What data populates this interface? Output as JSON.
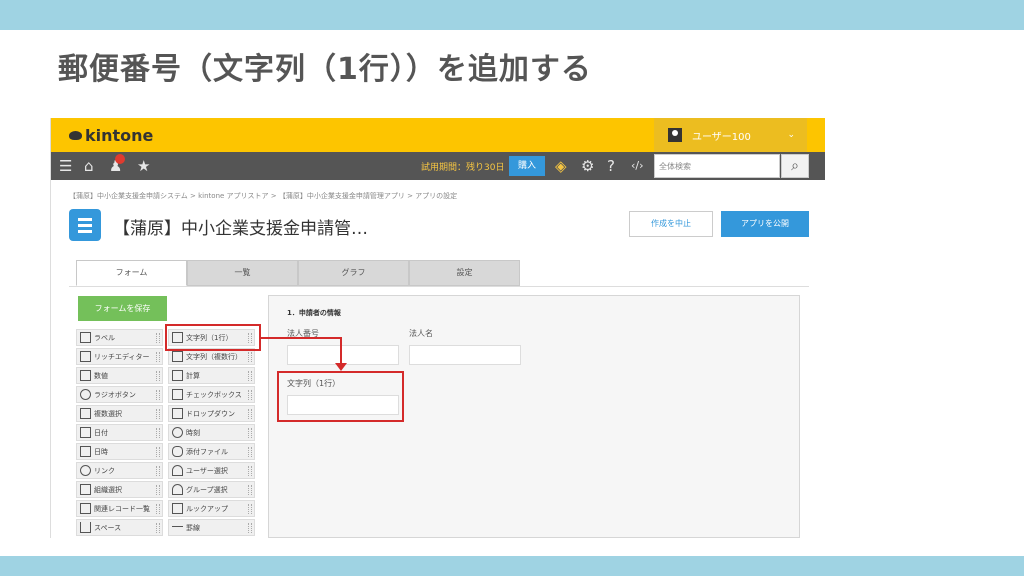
{
  "slide": {
    "title": "郵便番号（文字列（1行））を追加する"
  },
  "kintone": {
    "logo_text": "kintone",
    "user_name": "ユーザー100",
    "trial_text": "試用期間：残り30日",
    "buy_label": "購入",
    "search_placeholder": "全体検索",
    "breadcrumb": "【蒲原】中小企業支援金申請システム  >  kintone アプリストア  >  【蒲原】中小企業支援金申請管理アプリ  >  アプリの設定",
    "app_title": "【蒲原】中小企業支援金申請管…",
    "cancel_label": "作成を中止",
    "publish_label": "アプリを公開",
    "tabs": [
      {
        "label": "フォーム"
      },
      {
        "label": "一覧"
      },
      {
        "label": "グラフ"
      },
      {
        "label": "設定"
      }
    ],
    "save_form_label": "フォームを保存",
    "palette": [
      {
        "label": "ラベル",
        "icon": "label-icon"
      },
      {
        "label": "文字列（1行）",
        "icon": "text-single-icon"
      },
      {
        "label": "リッチエディター",
        "icon": "rich-editor-icon"
      },
      {
        "label": "文字列（複数行）",
        "icon": "text-multi-icon"
      },
      {
        "label": "数値",
        "icon": "number-icon"
      },
      {
        "label": "計算",
        "icon": "calc-icon"
      },
      {
        "label": "ラジオボタン",
        "icon": "radio-icon"
      },
      {
        "label": "チェックボックス",
        "icon": "checkbox-icon"
      },
      {
        "label": "複数選択",
        "icon": "multi-select-icon"
      },
      {
        "label": "ドロップダウン",
        "icon": "dropdown-icon"
      },
      {
        "label": "日付",
        "icon": "date-icon"
      },
      {
        "label": "時刻",
        "icon": "clock-icon"
      },
      {
        "label": "日時",
        "icon": "datetime-icon"
      },
      {
        "label": "添付ファイル",
        "icon": "attachment-icon"
      },
      {
        "label": "リンク",
        "icon": "link-icon"
      },
      {
        "label": "ユーザー選択",
        "icon": "user-select-icon"
      },
      {
        "label": "組織選択",
        "icon": "org-select-icon"
      },
      {
        "label": "グループ選択",
        "icon": "group-select-icon"
      },
      {
        "label": "関連レコード一覧",
        "icon": "related-records-icon"
      },
      {
        "label": "ルックアップ",
        "icon": "lookup-icon"
      },
      {
        "label": "スペース",
        "icon": "space-icon"
      },
      {
        "label": "罫線",
        "icon": "border-line-icon"
      }
    ],
    "canvas": {
      "group_label": "1．申請者の情報",
      "field_corp_number": "法人番号",
      "field_corp_name": "法人名",
      "field_text_single": "文字列（1行）"
    }
  },
  "colors": {
    "header_yellow": "#fdc500",
    "nav_gray": "#555555",
    "accent_blue": "#3498db",
    "save_green": "#74c05a",
    "highlight_red": "#d42a2a",
    "band_blue": "#9fd3e3"
  }
}
